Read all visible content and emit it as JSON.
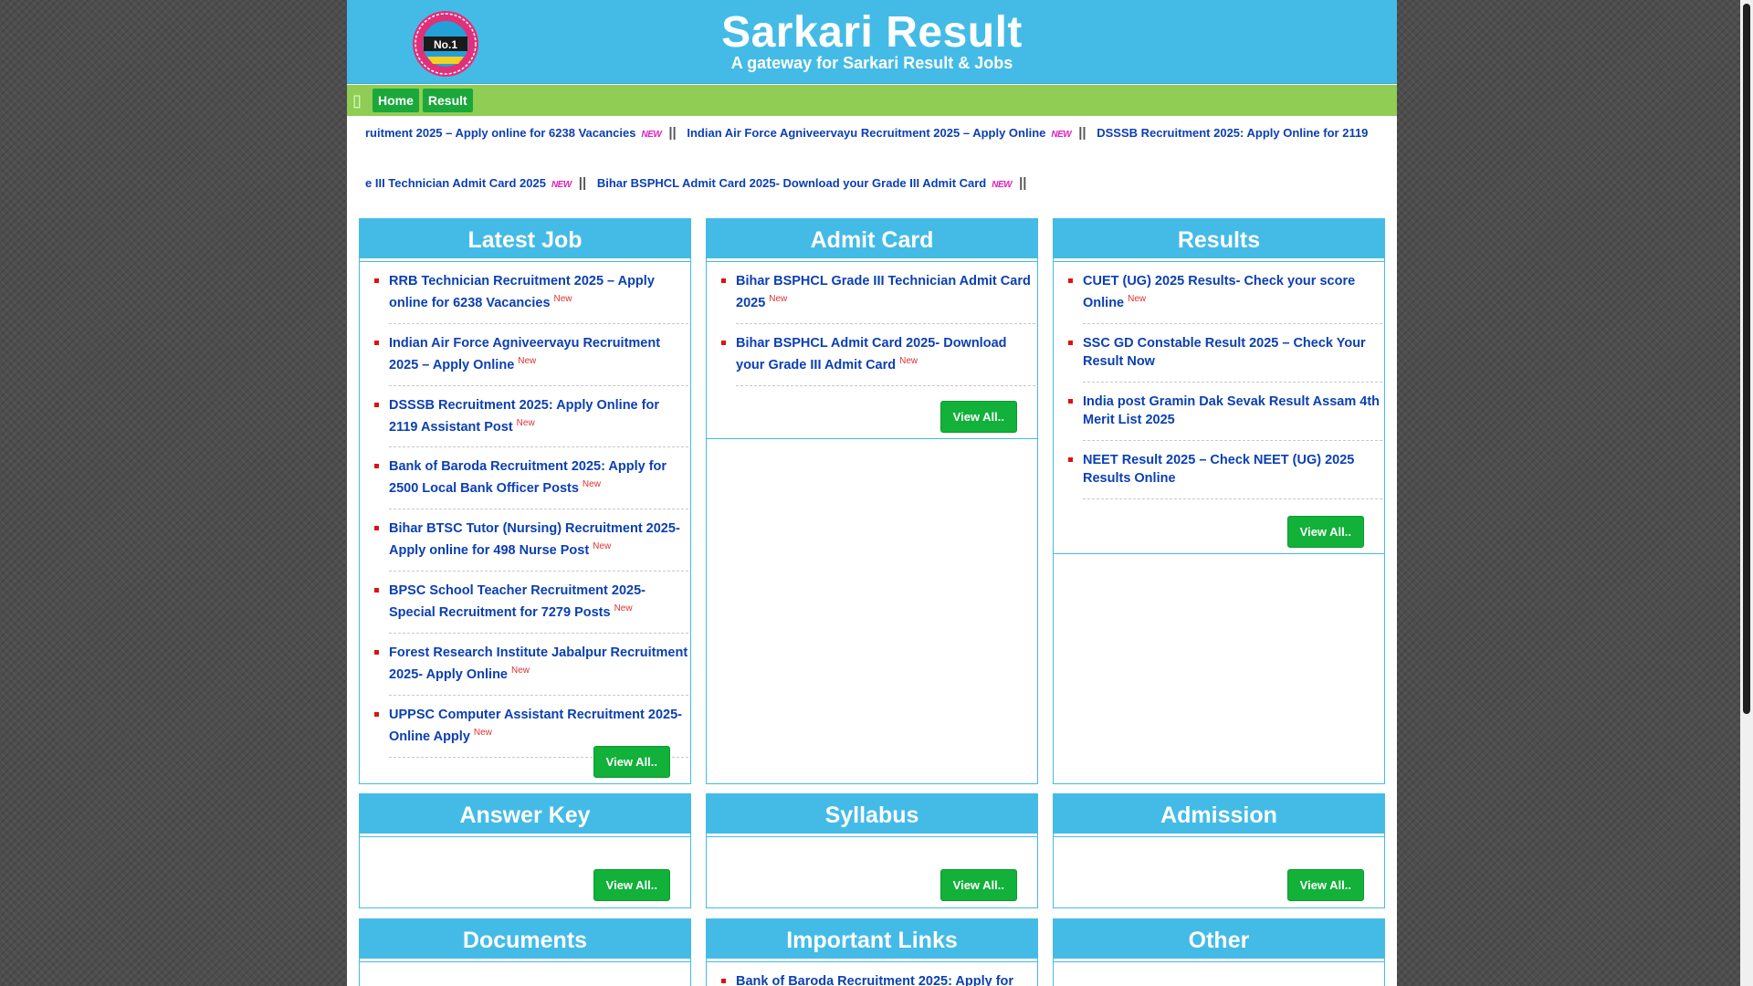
{
  "header": {
    "title": "Sarkari Result",
    "tagline": "A gateway for Sarkari Result & Jobs",
    "logo": {
      "badge_text": "No.1"
    }
  },
  "nav": {
    "items": [
      {
        "label": "Home"
      },
      {
        "label": "Result"
      }
    ]
  },
  "ticker": {
    "line1": [
      "ruitment 2025 – Apply online for 6238 Vacancies",
      "Indian Air Force Agniveervayu Recruitment 2025 – Apply Online",
      "DSSSB Recruitment 2025: Apply Online for 2119"
    ],
    "line2": [
      "e III Technician Admit Card 2025",
      "Bihar BSPHCL Admit Card 2025- Download your Grade III Admit Card"
    ],
    "new_label": "NEW",
    "separator": "||"
  },
  "sections": {
    "latest_job": {
      "title": "Latest Job",
      "items": [
        "RRB Technician Recruitment 2025 – Apply online for 6238 Vacancies",
        "Indian Air Force Agniveervayu Recruitment 2025 – Apply Online",
        "DSSSB Recruitment 2025: Apply Online for 2119 Assistant Post",
        "Bank of Baroda Recruitment 2025: Apply for 2500 Local Bank Officer Posts",
        "Bihar BTSC Tutor (Nursing) Recruitment 2025- Apply online for 498 Nurse Post",
        "BPSC School Teacher Recruitment 2025- Special Recruitment for 7279 Posts",
        "Forest Research Institute Jabalpur Recruitment 2025- Apply Online",
        "UPPSC Computer Assistant Recruitment 2025- Online Apply"
      ],
      "view_all": "View All.."
    },
    "admit_card": {
      "title": "Admit Card",
      "items": [
        "Bihar BSPHCL Grade III Technician Admit Card 2025",
        "Bihar BSPHCL Admit Card 2025- Download your Grade III Admit Card"
      ],
      "view_all": "View All.."
    },
    "results": {
      "title": "Results",
      "items": [
        "CUET (UG) 2025 Results- Check your score Online",
        "SSC GD Constable Result 2025 – Check Your Result Now",
        "India post Gramin Dak Sevak Result Assam 4th Merit List 2025",
        "NEET Result 2025 – Check NEET (UG) 2025 Results Online"
      ],
      "new_flags": [
        true,
        false,
        false,
        false
      ],
      "view_all": "View All.."
    },
    "answer_key": {
      "title": "Answer Key",
      "view_all": "View All.."
    },
    "syllabus": {
      "title": "Syllabus",
      "view_all": "View All.."
    },
    "admission": {
      "title": "Admission",
      "view_all": "View All.."
    },
    "documents": {
      "title": "Documents"
    },
    "important_links": {
      "title": "Important Links",
      "items": [
        "Bank of Baroda Recruitment 2025: Apply for"
      ]
    },
    "other": {
      "title": "Other"
    }
  },
  "new_tag": "New",
  "colors": {
    "header_blue": "#44bbe6",
    "nav_green": "#8fcd55",
    "button_green": "#11b13a",
    "link_blue": "#0b3fb3",
    "new_red": "#e03030"
  }
}
